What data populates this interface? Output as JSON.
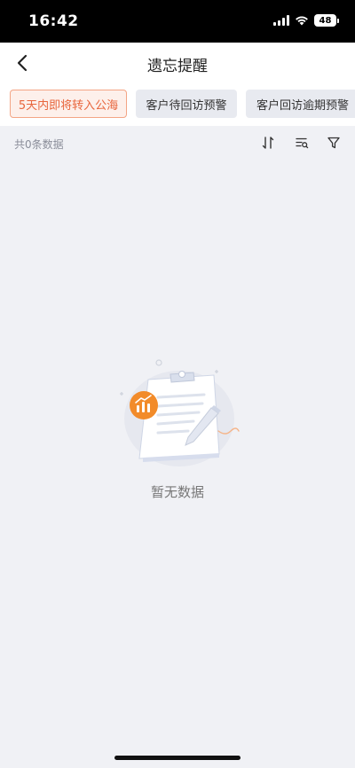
{
  "status_bar": {
    "time": "16:42",
    "battery": "48"
  },
  "nav": {
    "title": "遗忘提醒"
  },
  "tabs": [
    {
      "label": "5天内即将转入公海",
      "active": true
    },
    {
      "label": "客户待回访预警",
      "active": false
    },
    {
      "label": "客户回访逾期预警",
      "active": false
    }
  ],
  "toolbar": {
    "count_text": "共0条数据",
    "icons": [
      "sort-icon",
      "list-search-icon",
      "filter-icon"
    ]
  },
  "empty_state": {
    "text": "暂无数据"
  },
  "colors": {
    "accent": "#e8663d",
    "accent_bg": "#fdf0eb",
    "page_bg": "#f0f1f5",
    "badge": "#f28b2a"
  }
}
